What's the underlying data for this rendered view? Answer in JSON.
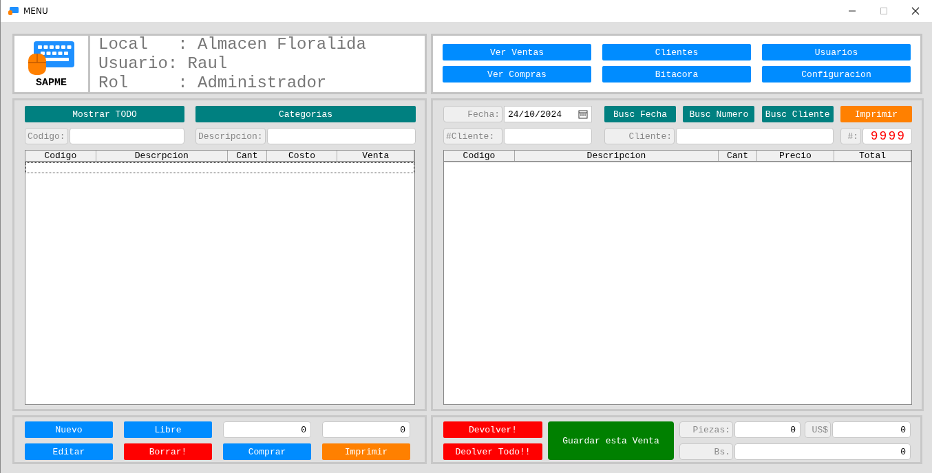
{
  "window": {
    "title": "MENU"
  },
  "header": {
    "logo_text": "SAPME",
    "lines": [
      "Local   : Almacen Floralida",
      "Usuario: Raul",
      "Rol     : Administrador"
    ]
  },
  "nav_buttons": [
    {
      "label": "Ver Ventas"
    },
    {
      "label": "Clientes"
    },
    {
      "label": "Usuarios"
    },
    {
      "label": "Ver Compras"
    },
    {
      "label": "Bitacora"
    },
    {
      "label": "Configuracion"
    }
  ],
  "products": {
    "top_buttons": [
      {
        "label": "Mostrar TODO"
      },
      {
        "label": "Categorias"
      }
    ],
    "filters": [
      {
        "label": "Codigo:"
      },
      {
        "label": "Descripcion:"
      }
    ],
    "table": {
      "columns": [
        "Codigo",
        "Descrpcion",
        "Cant",
        "Costo",
        "Venta"
      ]
    },
    "actions": [
      {
        "kind": "button",
        "label": "Nuevo",
        "color": "#008cff"
      },
      {
        "kind": "button",
        "label": "Libre",
        "color": "#008cff"
      },
      {
        "kind": "field",
        "value": "0"
      },
      {
        "kind": "field",
        "value": "0"
      },
      {
        "kind": "button",
        "label": "Editar",
        "color": "#008cff"
      },
      {
        "kind": "button",
        "label": "Borrar!",
        "color": "#ff0000"
      },
      {
        "kind": "button",
        "label": "Comprar",
        "color": "#008cff"
      },
      {
        "kind": "button",
        "label": "Imprimir",
        "color": "#ff8000"
      }
    ]
  },
  "sale": {
    "date": {
      "label": "Fecha:",
      "value": "24/10/2024"
    },
    "search_buttons": [
      {
        "label": "Busc Fecha",
        "color": "#008080"
      },
      {
        "label": "Busc Numero",
        "color": "#008080"
      },
      {
        "label": "Busc Cliente",
        "color": "#008080"
      },
      {
        "label": "Imprimir",
        "color": "#ff8000"
      }
    ],
    "client_number": {
      "label": "#Cliente:"
    },
    "client": {
      "label": "Cliente:"
    },
    "sale_number": {
      "label": "#:",
      "value": "9999"
    },
    "table": {
      "columns": [
        "Codigo",
        "Descripcion",
        "Cant",
        "Precio",
        "Total"
      ]
    },
    "return_buttons": [
      {
        "label": "Devolver!"
      },
      {
        "label": "Deolver Todo!!"
      }
    ],
    "save_button": {
      "label": "Guardar esta Venta"
    },
    "totals": [
      {
        "label": "Piezas:",
        "value": "0"
      },
      {
        "label": "US$",
        "value": "0"
      },
      {
        "label": "Bs.",
        "value": "0"
      }
    ]
  }
}
